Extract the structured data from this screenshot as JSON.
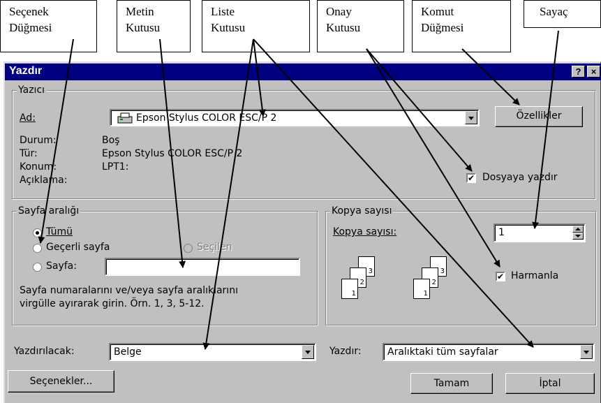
{
  "callouts": {
    "option_button": [
      "Seçenek",
      "Düğmesi"
    ],
    "text_box": [
      "Metin",
      "Kutusu"
    ],
    "list_box": [
      "Liste",
      "Kutusu"
    ],
    "check_box": [
      "Onay",
      "Kutusu"
    ],
    "command_button": [
      "Komut",
      "Düğmesi"
    ],
    "counter": [
      "Sayaç"
    ]
  },
  "dialog": {
    "title": "Yazdır",
    "help_label": "?",
    "close_label": "×"
  },
  "printer": {
    "group_label": "Yazıcı",
    "name_label": "Ad:",
    "name_value": "Epson Stylus COLOR ESC/P 2",
    "properties_label": "Özellikler",
    "status_label": "Durum:",
    "status_value": "Boş",
    "type_label": "Tür:",
    "type_value": "Epson Stylus COLOR ESC/P 2",
    "where_label": "Konum:",
    "where_value": "LPT1:",
    "comment_label": "Açıklama:",
    "print_to_file_label": "Dosyaya yazdır",
    "print_to_file_checked": true
  },
  "page_range": {
    "group_label": "Sayfa aralığı",
    "all_label": "Tümü",
    "current_label": "Geçerli sayfa",
    "selection_label": "Seçilen",
    "pages_label": "Sayfa:",
    "pages_value": "",
    "selected": "all",
    "hint_line1": "Sayfa numaralarını ve/veya sayfa aralıklarını",
    "hint_line2": "virgülle ayırarak girin. Örn. 1, 3, 5-12."
  },
  "copies": {
    "group_label": "Kopya sayısı",
    "count_label": "Kopya sayısı:",
    "count_value": "1",
    "collate_label": "Harmanla",
    "collate_checked": true,
    "page_numbers": [
      "3",
      "2",
      "1"
    ]
  },
  "bottom": {
    "print_what_label": "Yazdırılacak:",
    "print_what_value": "Belge",
    "print_label": "Yazdır:",
    "print_value": "Aralıktaki tüm sayfalar",
    "options_label": "Seçenekler...",
    "ok_label": "Tamam",
    "cancel_label": "İptal"
  }
}
